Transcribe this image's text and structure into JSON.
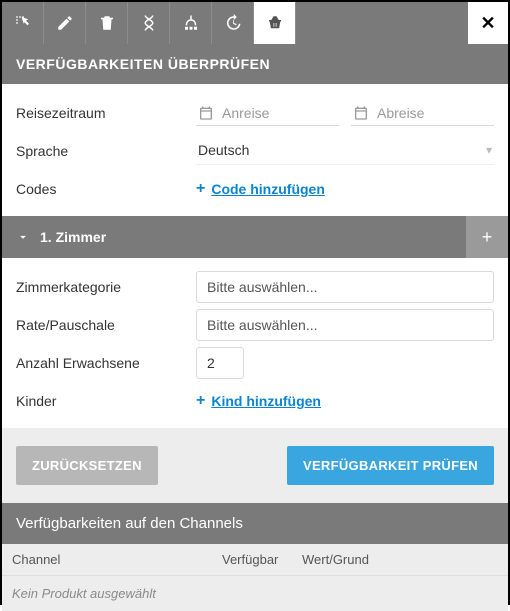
{
  "toolbar": {
    "icons": [
      "select-icon",
      "pencil-icon",
      "trash-icon",
      "dna-icon",
      "sitemap-icon",
      "clock-icon",
      "basket-icon"
    ],
    "close_label": "✕"
  },
  "panel": {
    "title": "VERFÜGBARKEITEN ÜBERPRÜFEN"
  },
  "form": {
    "period_label": "Reisezeitraum",
    "arrival_placeholder": "Anreise",
    "departure_placeholder": "Abreise",
    "language_label": "Sprache",
    "language_value": "Deutsch",
    "codes_label": "Codes",
    "add_code_label": "Code hinzufügen"
  },
  "room": {
    "header": "1. Zimmer",
    "category_label": "Zimmerkategorie",
    "category_placeholder": "Bitte auswählen...",
    "rate_label": "Rate/Pauschale",
    "rate_placeholder": "Bitte auswählen...",
    "adults_label": "Anzahl Erwachsene",
    "adults_value": "2",
    "children_label": "Kinder",
    "add_child_label": "Kind hinzufügen"
  },
  "actions": {
    "reset": "ZURÜCKSETZEN",
    "check": "VERFÜGBARKEIT PRÜFEN"
  },
  "channels": {
    "title": "Verfügbarkeiten auf den Channels",
    "col_channel": "Channel",
    "col_available": "Verfügbar",
    "col_value": "Wert/Grund",
    "empty": "Kein Produkt ausgewählt"
  }
}
